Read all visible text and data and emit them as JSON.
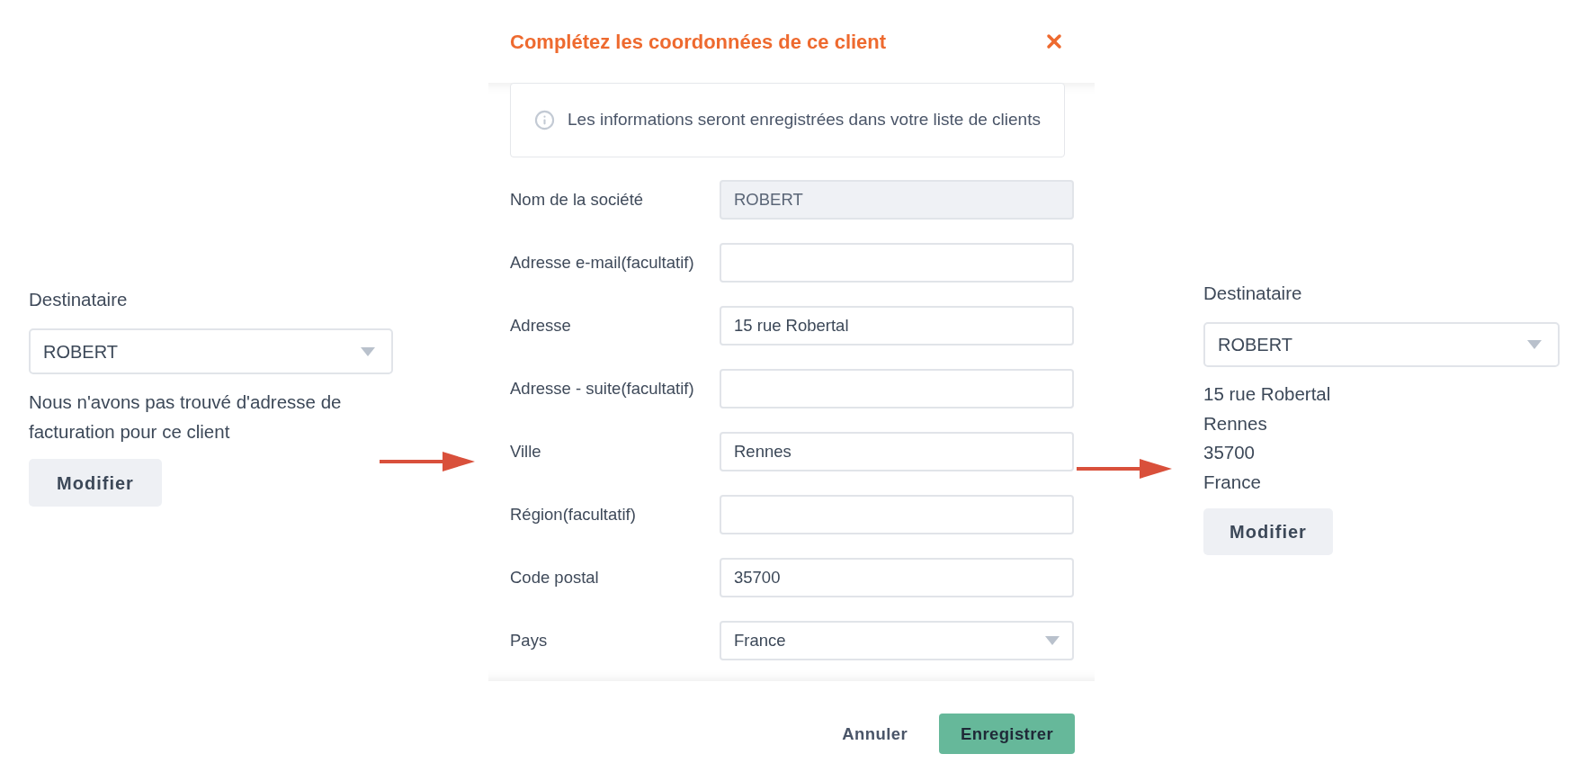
{
  "left_panel": {
    "label": "Destinataire",
    "select": {
      "value": "ROBERT"
    },
    "message": "Nous n'avons pas trouvé d'adresse de facturation pour ce client",
    "button": "Modifier"
  },
  "modal": {
    "title": "Complétez les coordonnées de ce client",
    "notice": "Les informations seront enregistrées dans votre liste de clients",
    "fields": [
      {
        "label": "Nom de la société",
        "value": "ROBERT",
        "kind": "text",
        "disabled": true
      },
      {
        "label": "Adresse e-mail(facultatif)",
        "kind": "text",
        "disabled": false
      },
      {
        "label": "Adresse",
        "value": "15 rue Robertal",
        "kind": "text",
        "disabled": false
      },
      {
        "label": "Adresse - suite(facultatif)",
        "kind": "text",
        "disabled": false
      },
      {
        "label": "Ville",
        "value": "Rennes",
        "kind": "text",
        "disabled": false
      },
      {
        "label": "Région(facultatif)",
        "kind": "text",
        "disabled": false
      },
      {
        "label": "Code postal",
        "value": "35700",
        "kind": "text",
        "disabled": false
      },
      {
        "label": "Pays",
        "value": "France",
        "kind": "select",
        "disabled": false
      }
    ],
    "buttons": [
      {
        "label": "Annuler",
        "kind": "secondary"
      },
      {
        "label": "Enregistrer",
        "kind": "primary"
      }
    ]
  },
  "right_panel": {
    "label": "Destinataire",
    "select": {
      "value": "ROBERT"
    },
    "address_lines": [
      "15 rue Robertal",
      "Rennes",
      "35700",
      "France"
    ],
    "button": "Modifier"
  }
}
